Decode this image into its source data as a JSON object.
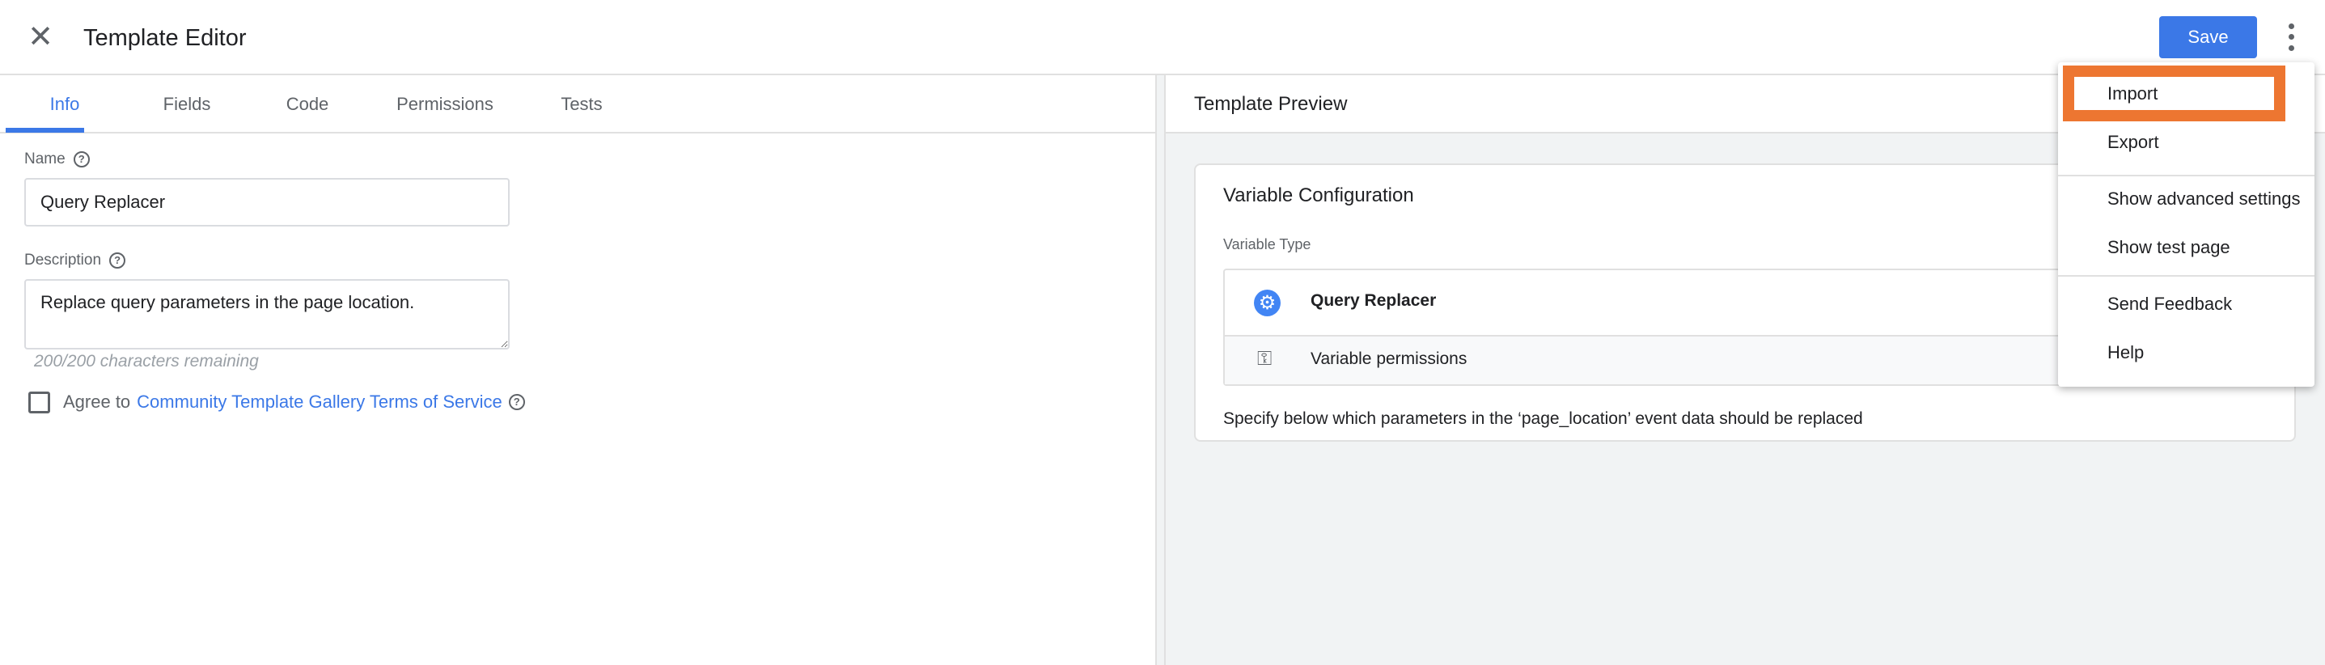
{
  "header": {
    "title": "Template Editor",
    "save_label": "Save"
  },
  "tabs": [
    {
      "label": "Info",
      "active": true
    },
    {
      "label": "Fields"
    },
    {
      "label": "Code"
    },
    {
      "label": "Permissions"
    },
    {
      "label": "Tests"
    }
  ],
  "info": {
    "name_label": "Name",
    "name_value": "Query Replacer",
    "description_label": "Description",
    "description_value": "Replace query parameters in the page location.",
    "chars_remaining": "200/200 characters remaining",
    "agree_prefix": "Agree to",
    "agree_link": "Community Template Gallery Terms of Service",
    "agree_checked": false
  },
  "preview": {
    "title": "Template Preview",
    "card_title": "Variable Configuration",
    "variable_type_label": "Variable Type",
    "variable_name": "Query Replacer",
    "permissions_label": "Variable permissions",
    "description": "Specify below which parameters in the ‘page_location’ event data should be replaced"
  },
  "menu": {
    "items": [
      "Import",
      "Export",
      "Show advanced settings",
      "Show test page",
      "Send Feedback",
      "Help"
    ],
    "highlighted": "Import"
  },
  "colors": {
    "accent": "#3b78e7",
    "highlight": "#ed7631"
  }
}
